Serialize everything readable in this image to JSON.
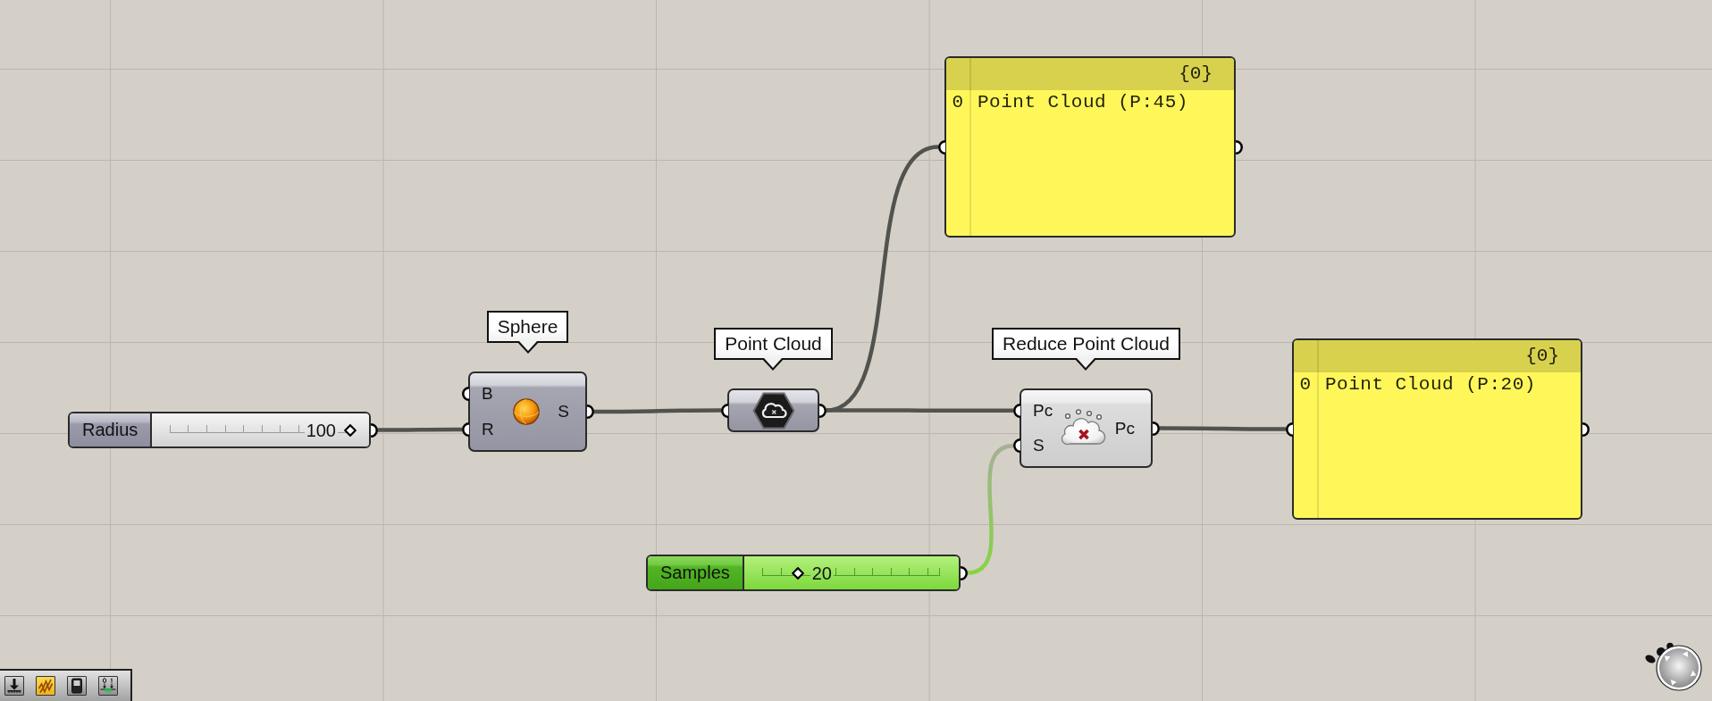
{
  "canvas": {
    "nodes": [
      {
        "kind": "slider",
        "label": "Radius",
        "value": "100",
        "level": 1,
        "selected": false
      },
      {
        "kind": "component",
        "name": "Sphere",
        "inputs": [
          "B",
          "R"
        ],
        "outputs": [
          "S"
        ],
        "preview": true,
        "selected": false
      },
      {
        "kind": "param",
        "name": "Point Cloud",
        "preview": true,
        "selected": false
      },
      {
        "kind": "panel",
        "path": "{0}",
        "rows": [
          {
            "index": "0",
            "value": "Point Cloud (P:45)"
          }
        ],
        "selected": false
      },
      {
        "kind": "component",
        "name": "Reduce Point Cloud",
        "inputs": [
          "Pc",
          "S"
        ],
        "outputs": [
          "Pc"
        ],
        "preview": false,
        "selected": false
      },
      {
        "kind": "panel",
        "path": "{0}",
        "rows": [
          {
            "index": "0",
            "value": "Point Cloud (P:20)"
          }
        ],
        "selected": false
      },
      {
        "kind": "slider",
        "label": "Samples",
        "value": "20",
        "level": 0.2,
        "selected": true
      }
    ]
  },
  "toolbar": {
    "buttons": [
      {
        "selected": false
      },
      {
        "selected": true
      },
      {
        "selected": false
      },
      {
        "selected": false
      }
    ]
  }
}
